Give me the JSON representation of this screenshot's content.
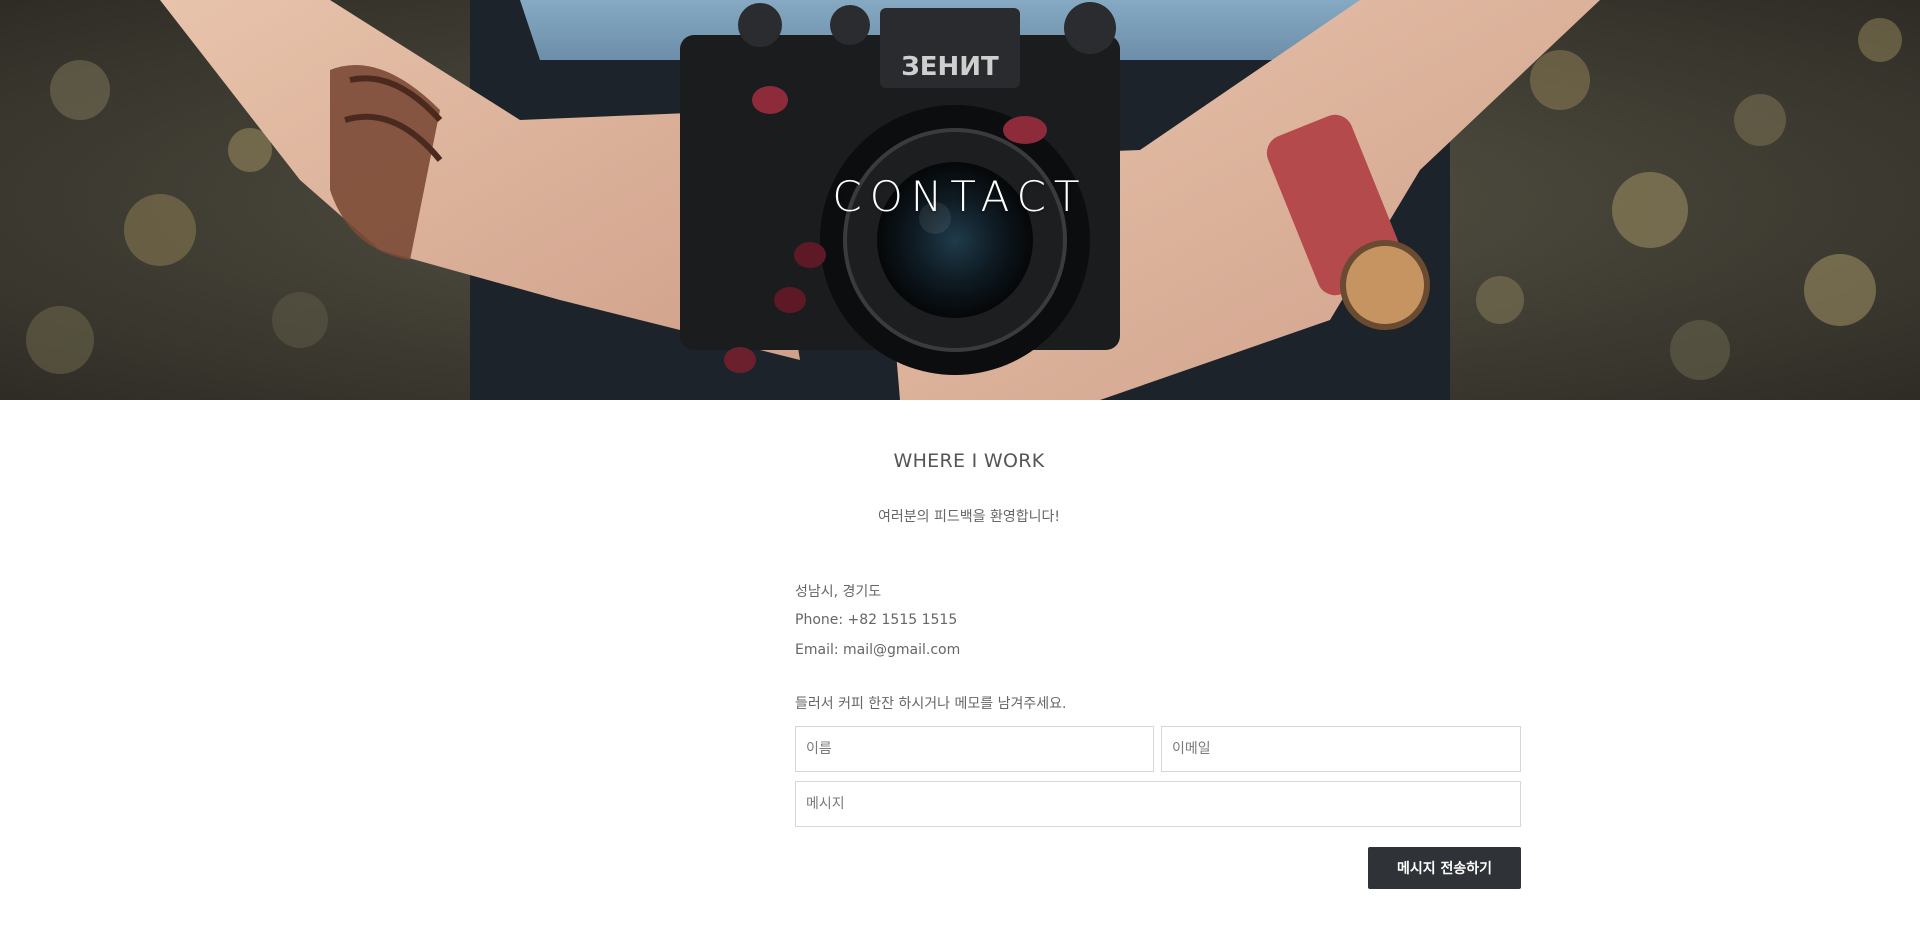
{
  "hero": {
    "title": "CONTACT",
    "camera_brand": "ЗЕНИТ"
  },
  "section": {
    "heading": "WHERE I WORK",
    "subtitle": "여러분의 피드백을 환영합니다!"
  },
  "contact_info": {
    "location": "성남시, 경기도",
    "phone": "Phone: +82 1515 1515",
    "email": "Email: mail@gmail.com"
  },
  "form": {
    "intro": "들러서 커피 한잔 하시거나 메모를 남겨주세요.",
    "name_placeholder": "이름",
    "email_placeholder": "이메일",
    "message_placeholder": "메시지",
    "submit_label": "메시지 전송하기"
  },
  "colors": {
    "button_bg": "#2f3237",
    "text": "#555555",
    "field_border": "#d7d7d7"
  }
}
